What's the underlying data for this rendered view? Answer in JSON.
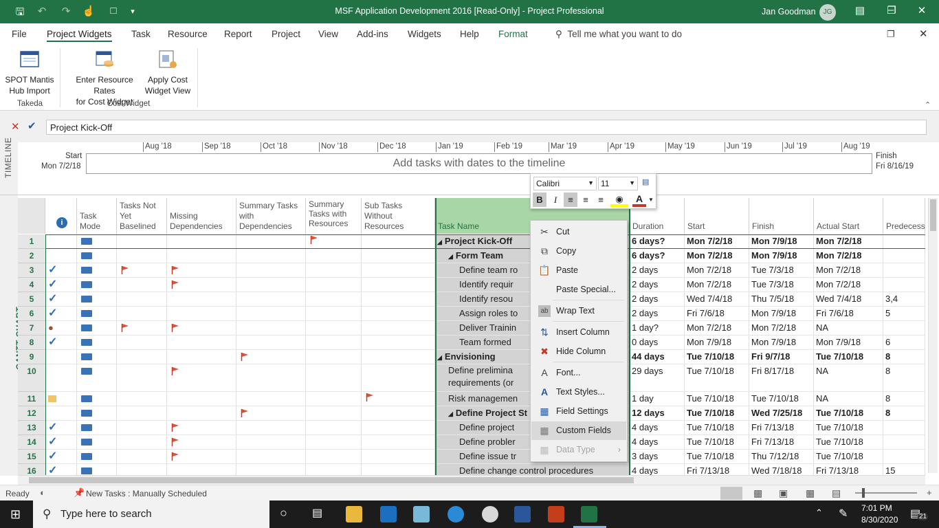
{
  "window": {
    "title": "MSF Application Development 2016 [Read-Only]  -  Project Professional",
    "user_name": "Jan Goodman",
    "user_initials": "JG"
  },
  "tabs": [
    "File",
    "Project Widgets",
    "Task",
    "Resource",
    "Report",
    "Project",
    "View",
    "Add-ins",
    "Widgets",
    "Help",
    "Format"
  ],
  "active_tab": "Project Widgets",
  "tell_me": "Tell me what you want to do",
  "ribbon": {
    "spot_line1": "SPOT Mantis",
    "spot_line2": "Hub Import",
    "enter_line1": "Enter Resource Rates",
    "enter_line2": "for Cost Widget",
    "apply_line1": "Apply Cost",
    "apply_line2": "Widget View",
    "group_takeda": "Takeda",
    "group_cost": "Cost Widget"
  },
  "entry_bar": {
    "value": "Project Kick-Off"
  },
  "timeline": {
    "label": "TIMELINE",
    "start_label": "Start",
    "start_date": "Mon 7/2/18",
    "finish_label": "Finish",
    "finish_date": "Fri 8/16/19",
    "placeholder": "Add tasks with dates to the timeline",
    "months": [
      "Aug '18",
      "Sep '18",
      "Oct '18",
      "Nov '18",
      "Dec '18",
      "Jan '19",
      "Feb '19",
      "Mar '19",
      "Apr '19",
      "May '19",
      "Jun '19",
      "Jul '19",
      "Aug '19"
    ]
  },
  "gantt_label": "GANTT CHART",
  "columns": {
    "task_mode": "Task Mode",
    "not_baselined": "Tasks Not Yet Baselined",
    "missing_deps": "Missing Dependencies",
    "summary_deps": "Summary Tasks with Dependencies",
    "summary_res": "Summary Tasks with Resources",
    "sub_tasks": "Sub Tasks Without Resources",
    "task_name": "Task Name",
    "duration": "Duration",
    "start": "Start",
    "finish": "Finish",
    "actual_start": "Actual Start",
    "predecessors": "Predecessors"
  },
  "rows": [
    {
      "id": "1",
      "name": "Project Kick-Off",
      "duration": "6 days?",
      "start": "Mon 7/2/18",
      "finish": "Mon 7/9/18",
      "actual": "Mon 7/2/18",
      "pred": ""
    },
    {
      "id": "2",
      "name": "Form Team",
      "duration": "6 days?",
      "start": "Mon 7/2/18",
      "finish": "Mon 7/9/18",
      "actual": "Mon 7/2/18",
      "pred": ""
    },
    {
      "id": "3",
      "name": "Define team ro",
      "duration": "2 days",
      "start": "Mon 7/2/18",
      "finish": "Tue 7/3/18",
      "actual": "Mon 7/2/18",
      "pred": ""
    },
    {
      "id": "4",
      "name": "Identify requir",
      "duration": "2 days",
      "start": "Mon 7/2/18",
      "finish": "Tue 7/3/18",
      "actual": "Mon 7/2/18",
      "pred": ""
    },
    {
      "id": "5",
      "name": "Identify resou",
      "duration": "2 days",
      "start": "Wed 7/4/18",
      "finish": "Thu 7/5/18",
      "actual": "Wed 7/4/18",
      "pred": "3,4"
    },
    {
      "id": "6",
      "name": "Assign roles to",
      "duration": "2 days",
      "start": "Fri 7/6/18",
      "finish": "Mon 7/9/18",
      "actual": "Fri 7/6/18",
      "pred": "5"
    },
    {
      "id": "7",
      "name": "Deliver Trainin",
      "duration": "1 day?",
      "start": "Mon 7/2/18",
      "finish": "Mon 7/2/18",
      "actual": "NA",
      "pred": ""
    },
    {
      "id": "8",
      "name": "Team formed",
      "duration": "0 days",
      "start": "Mon 7/9/18",
      "finish": "Mon 7/9/18",
      "actual": "Mon 7/9/18",
      "pred": "6"
    },
    {
      "id": "9",
      "name": "Envisioning",
      "duration": "44 days",
      "start": "Tue 7/10/18",
      "finish": "Fri 9/7/18",
      "actual": "Tue 7/10/18",
      "pred": "8"
    },
    {
      "id": "10",
      "name": "Define prelimina",
      "name2": "requirements (or",
      "duration": "29 days",
      "start": "Tue 7/10/18",
      "finish": "Fri 8/17/18",
      "actual": "NA",
      "pred": "8"
    },
    {
      "id": "11",
      "name": "Risk managemen",
      "duration": "1 day",
      "start": "Tue 7/10/18",
      "finish": "Tue 7/10/18",
      "actual": "NA",
      "pred": "8"
    },
    {
      "id": "12",
      "name": "Define Project St",
      "duration": "12 days",
      "start": "Tue 7/10/18",
      "finish": "Wed 7/25/18",
      "actual": "Tue 7/10/18",
      "pred": "8"
    },
    {
      "id": "13",
      "name": "Define project",
      "duration": "4 days",
      "start": "Tue 7/10/18",
      "finish": "Fri 7/13/18",
      "actual": "Tue 7/10/18",
      "pred": ""
    },
    {
      "id": "14",
      "name": "Define probler",
      "duration": "4 days",
      "start": "Tue 7/10/18",
      "finish": "Fri 7/13/18",
      "actual": "Tue 7/10/18",
      "pred": ""
    },
    {
      "id": "15",
      "name": "Define issue tr",
      "duration": "3 days",
      "start": "Tue 7/10/18",
      "finish": "Thu 7/12/18",
      "actual": "Tue 7/10/18",
      "pred": ""
    },
    {
      "id": "16",
      "name": "Define change control procedures",
      "duration": "4 days",
      "start": "Fri 7/13/18",
      "finish": "Wed 7/18/18",
      "actual": "Fri 7/13/18",
      "pred": "15"
    }
  ],
  "mini_toolbar": {
    "font": "Calibri",
    "size": "11",
    "bold": "B",
    "italic": "I",
    "color_a": "A"
  },
  "context_menu": {
    "cut": "Cut",
    "copy": "Copy",
    "paste": "Paste",
    "paste_special": "Paste Special...",
    "wrap_text": "Wrap Text",
    "insert_column": "Insert Column",
    "hide_column": "Hide Column",
    "font": "Font...",
    "text_styles": "Text Styles...",
    "field_settings": "Field Settings",
    "custom_fields": "Custom Fields",
    "data_type": "Data Type"
  },
  "status": {
    "ready": "Ready",
    "new_tasks": "New Tasks : Manually Scheduled"
  },
  "taskbar": {
    "search": "Type here to search",
    "time": "7:01 PM",
    "date": "8/30/2020",
    "notifications": "21"
  },
  "colors": {
    "accent": "#217346",
    "taskname_header": "#a9d6a7",
    "flag": "#d9533a",
    "check": "#2a6fb5"
  }
}
